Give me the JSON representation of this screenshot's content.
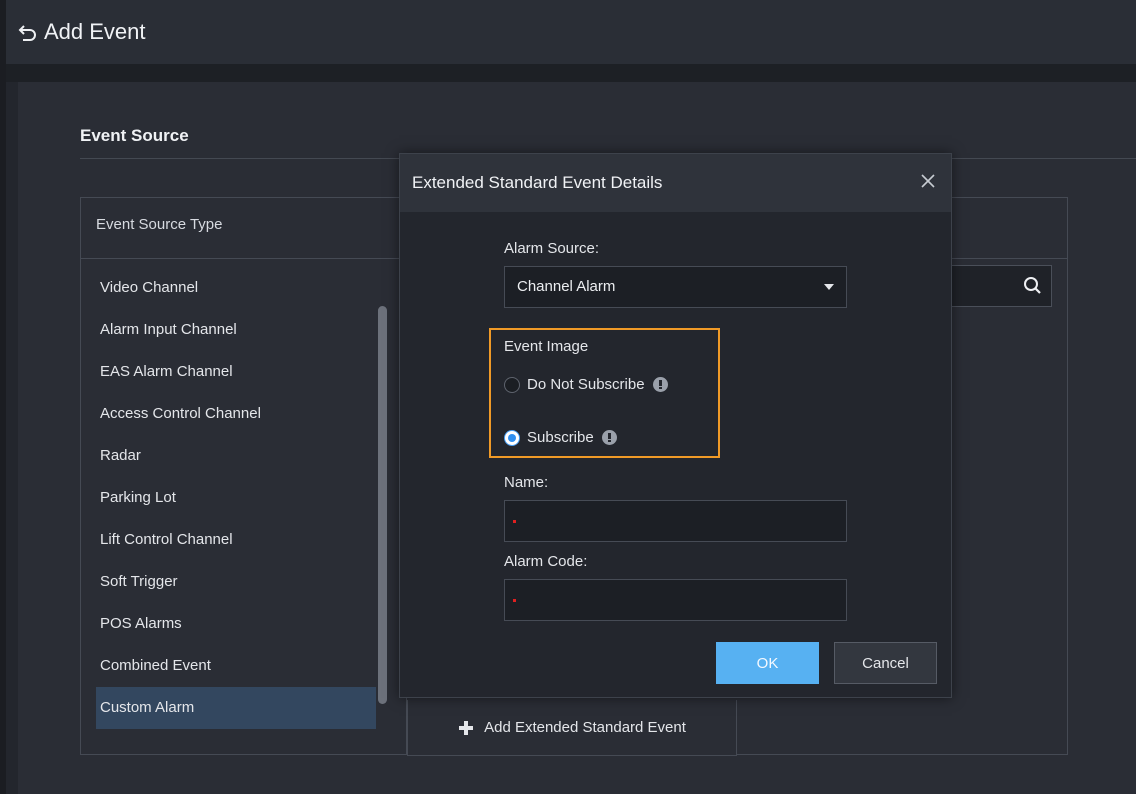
{
  "header": {
    "title": "Add Event"
  },
  "section": {
    "title": "Event Source"
  },
  "event_source": {
    "column_header": "Event Source Type",
    "items": [
      "Video Channel",
      "Alarm Input Channel",
      "EAS Alarm Channel",
      "Access Control Channel",
      "Radar",
      "Parking Lot",
      "Lift Control Channel",
      "Soft Trigger",
      "POS Alarms",
      "Combined Event",
      "Custom Alarm"
    ],
    "selected": "Custom Alarm",
    "add_button_label": "Add Extended Standard Event"
  },
  "modal": {
    "title": "Extended Standard Event Details",
    "alarm_source_label": "Alarm Source:",
    "alarm_source_value": "Channel Alarm",
    "event_image_label": "Event Image",
    "option_not_subscribe": "Do Not Subscribe",
    "option_subscribe": "Subscribe",
    "selected_option": "Subscribe",
    "name_label": "Name:",
    "name_value": "",
    "alarm_code_label": "Alarm Code:",
    "alarm_code_value": "",
    "ok_label": "OK",
    "cancel_label": "Cancel"
  },
  "colors": {
    "highlight": "#f09a27",
    "primary": "#57b1f2",
    "selected_row": "#33475f"
  }
}
